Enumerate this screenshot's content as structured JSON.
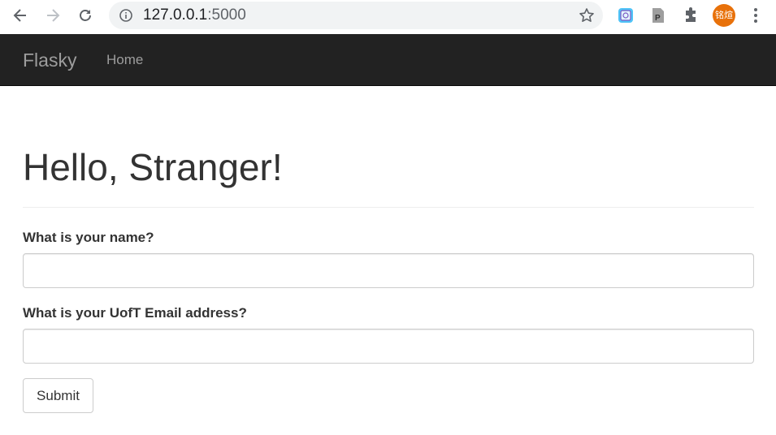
{
  "browser": {
    "url_host": "127.0.0.1",
    "url_port": ":5000",
    "avatar_text": "铭煊"
  },
  "navbar": {
    "brand": "Flasky",
    "links": [
      {
        "label": "Home"
      }
    ]
  },
  "main": {
    "heading": "Hello, Stranger!",
    "form": {
      "name_label": "What is your name?",
      "name_value": "",
      "email_label": "What is your UofT Email address?",
      "email_value": "",
      "submit_label": "Submit"
    }
  },
  "icons": {
    "back": "arrow-left-icon",
    "forward": "arrow-right-icon",
    "reload": "reload-icon",
    "info": "info-icon",
    "star": "star-icon",
    "extensions": [
      "screenshot-extension-icon",
      "p-extension-icon",
      "puzzle-icon"
    ],
    "menu": "more-vert-icon"
  }
}
